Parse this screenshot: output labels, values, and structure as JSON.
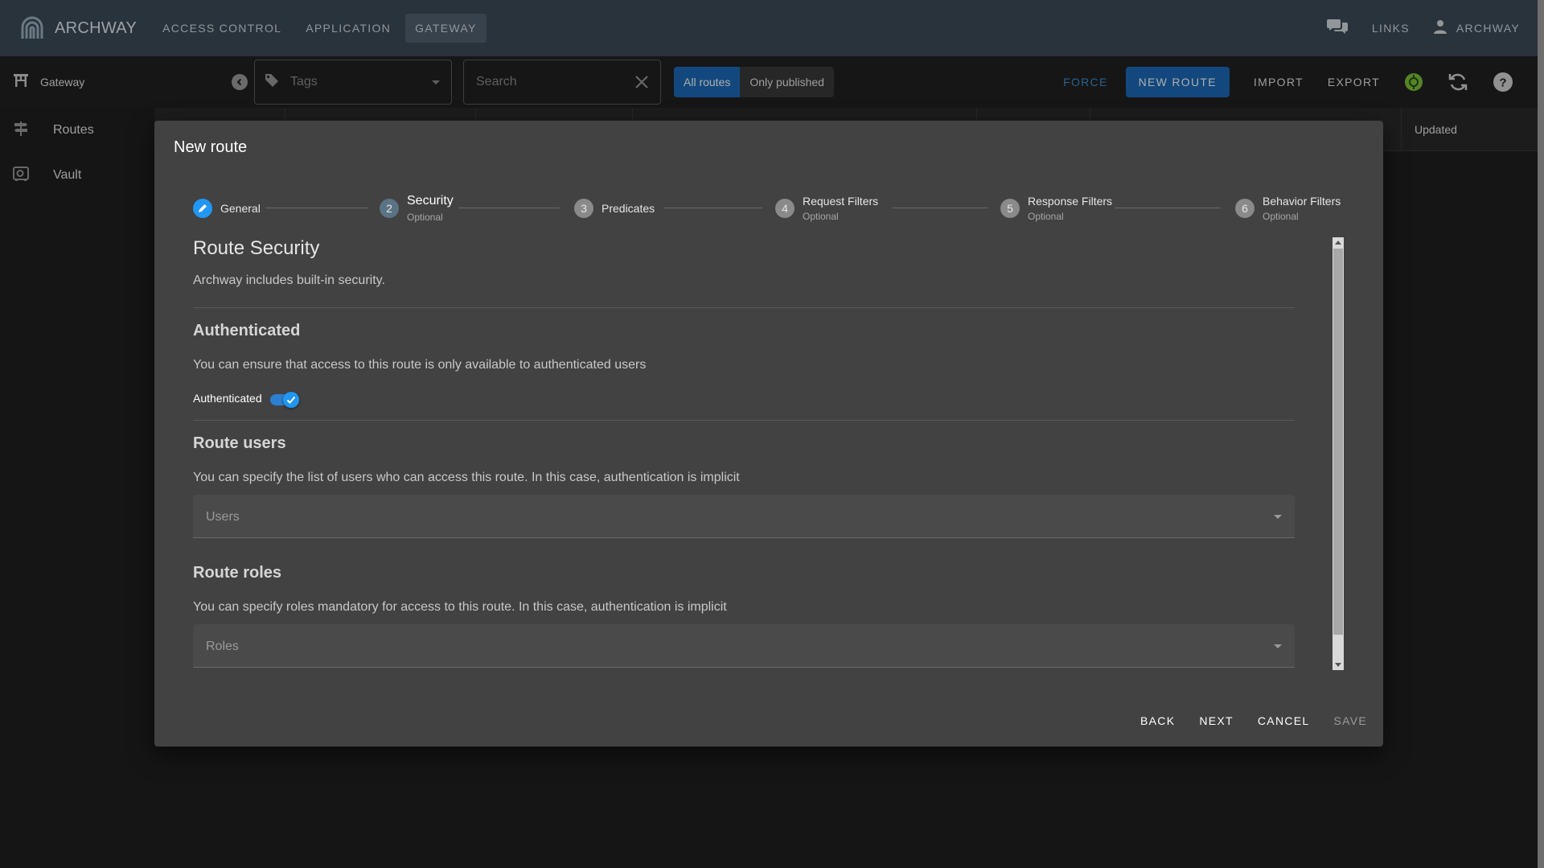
{
  "appbar": {
    "brand": "ARCHWAY",
    "nav": [
      "ACCESS CONTROL",
      "APPLICATION",
      "GATEWAY"
    ],
    "active_nav": "GATEWAY",
    "links": "LINKS",
    "user": "ARCHWAY"
  },
  "toolbar": {
    "title": "Gateway",
    "tags_placeholder": "Tags",
    "search_placeholder": "Search",
    "filter_all": "All routes",
    "filter_published": "Only published",
    "force": "FORCE",
    "new_route": "NEW ROUTE",
    "import": "IMPORT",
    "export": "EXPORT",
    "status_color": "#7cc43a"
  },
  "sidebar": {
    "items": [
      {
        "label": "Routes",
        "icon": "signpost-icon"
      },
      {
        "label": "Vault",
        "icon": "vault-icon"
      }
    ]
  },
  "table": {
    "updated_header": "Updated"
  },
  "dialog": {
    "title": "New route",
    "steps": [
      {
        "num": "✓",
        "name": "General",
        "optional": "",
        "state": "done"
      },
      {
        "num": "2",
        "name": "Security",
        "optional": "Optional",
        "state": "current"
      },
      {
        "num": "3",
        "name": "Predicates",
        "optional": "",
        "state": "todo"
      },
      {
        "num": "4",
        "name": "Request Filters",
        "optional": "Optional",
        "state": "todo"
      },
      {
        "num": "5",
        "name": "Response Filters",
        "optional": "Optional",
        "state": "todo"
      },
      {
        "num": "6",
        "name": "Behavior Filters",
        "optional": "Optional",
        "state": "todo"
      }
    ],
    "section_title": "Route Security",
    "section_desc": "Archway includes built-in security.",
    "authenticated": {
      "title": "Authenticated",
      "desc": "You can ensure that access to this route is only available to authenticated users",
      "toggle_label": "Authenticated",
      "toggle_on": true
    },
    "users": {
      "title": "Route users",
      "desc": "You can specify the list of users who can access this route. In this case, authentication is implicit",
      "placeholder": "Users"
    },
    "roles": {
      "title": "Route roles",
      "desc": "You can specify roles mandatory for access to this route. In this case, authentication is implicit",
      "placeholder": "Roles"
    },
    "actions": {
      "back": "BACK",
      "next": "NEXT",
      "cancel": "CANCEL",
      "save": "SAVE"
    }
  }
}
